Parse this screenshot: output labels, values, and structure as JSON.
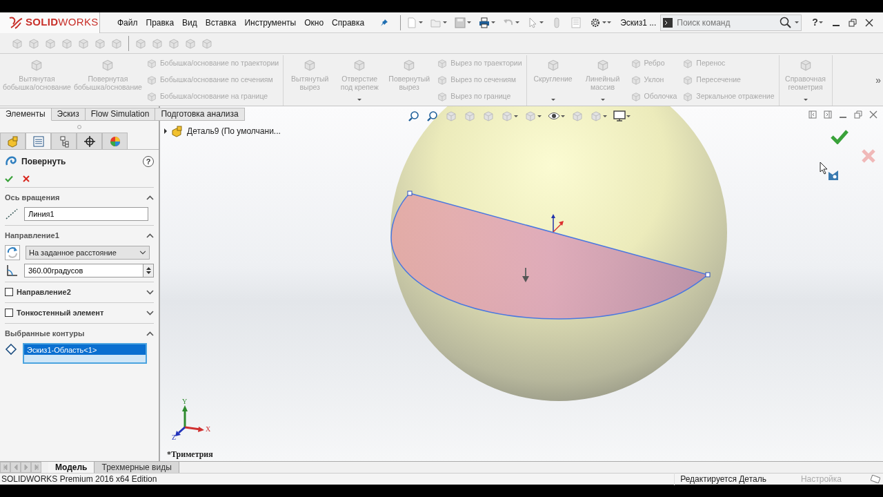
{
  "menu_bar": {
    "logo": "**SOLID**WORKS",
    "menus": [
      "Файл",
      "Правка",
      "Вид",
      "Вставка",
      "Инструменты",
      "Окно",
      "Справка"
    ],
    "document_title": "Эскиз1 ...",
    "search": {
      "placeholder": "Поиск команд"
    },
    "help": "?"
  },
  "ribbon": {
    "groups": [
      {
        "items": [
          {
            "kind": "large",
            "label": "Вытянутая бобышка/основание",
            "dropdown": false,
            "disabled": true
          },
          {
            "kind": "large",
            "label": "Повернутая бобышка/основание",
            "dropdown": false,
            "disabled": true
          },
          {
            "kind": "stack",
            "rows": [
              {
                "label": "Бобышка/основание по траектории",
                "disabled": true
              },
              {
                "label": "Бобышка/основание по сечениям",
                "disabled": true
              },
              {
                "label": "Бобышка/основание на границе",
                "disabled": true
              }
            ]
          }
        ]
      },
      {
        "items": [
          {
            "kind": "large",
            "label": "Вытянутый вырез",
            "dropdown": false,
            "disabled": true
          },
          {
            "kind": "large",
            "label": "Отверстие под крепеж",
            "dropdown": true,
            "disabled": true
          },
          {
            "kind": "large",
            "label": "Повернутый вырез",
            "dropdown": false,
            "disabled": true
          },
          {
            "kind": "stack",
            "rows": [
              {
                "label": "Вырез по траектории",
                "disabled": true
              },
              {
                "label": "Вырез по сечениям",
                "disabled": true
              },
              {
                "label": "Вырез по границе",
                "disabled": true
              }
            ]
          }
        ]
      },
      {
        "items": [
          {
            "kind": "large",
            "label": "Скругление",
            "dropdown": true,
            "disabled": true
          },
          {
            "kind": "large",
            "label": "Линейный массив",
            "dropdown": true,
            "disabled": true
          },
          {
            "kind": "stack",
            "rows": [
              {
                "label": "Ребро",
                "disabled": true
              },
              {
                "label": "Уклон",
                "disabled": true
              },
              {
                "label": "Оболочка",
                "disabled": true
              }
            ]
          },
          {
            "kind": "stack",
            "rows": [
              {
                "label": "Перенос",
                "disabled": true
              },
              {
                "label": "Пересечение",
                "disabled": true
              },
              {
                "label": "Зеркальное отражение",
                "disabled": true
              }
            ]
          }
        ]
      },
      {
        "items": [
          {
            "kind": "large",
            "label": "Справочная геометрия",
            "dropdown": true,
            "disabled": true
          }
        ]
      }
    ],
    "overflow": "»"
  },
  "command_tabs": [
    {
      "label": "Элементы",
      "selected": true
    },
    {
      "label": "Эскиз",
      "selected": false
    },
    {
      "label": "Flow Simulation",
      "selected": false
    },
    {
      "label": "Подготовка анализа",
      "selected": false
    }
  ],
  "panel_tabs": [
    {
      "kind": "parts",
      "selected": false
    },
    {
      "kind": "properties",
      "selected": true
    },
    {
      "kind": "configurations",
      "selected": false
    },
    {
      "kind": "target",
      "selected": false
    },
    {
      "kind": "appearance",
      "selected": false
    }
  ],
  "property_manager": {
    "title": "Повернуть",
    "help": "?",
    "sections": [
      {
        "kind": "axis",
        "title": "Ось вращения",
        "expanded": true,
        "value": "Линия1"
      },
      {
        "kind": "direction",
        "title": "Направление1",
        "expanded": true,
        "end_condition": "На заданное расстояние",
        "angle": "360.00градусов"
      },
      {
        "kind": "option",
        "title": "Направление2",
        "checked": false,
        "expanded": false
      },
      {
        "kind": "option",
        "title": "Тонкостенный элемент",
        "checked": false,
        "expanded": false
      },
      {
        "kind": "contours",
        "title": "Выбранные контуры",
        "expanded": true,
        "items": [
          {
            "label": "Эскиз1-Область<1>",
            "selected": true
          }
        ]
      }
    ]
  },
  "feature_tree": {
    "root": {
      "label": "Деталь9  (По умолчани...",
      "expanded": false
    }
  },
  "viewport": {
    "view_name": "*Триметрия",
    "axes": [
      "X",
      "Y",
      "Z"
    ]
  },
  "bottom_tabs": [
    {
      "label": "Модель",
      "selected": true
    },
    {
      "label": "Трехмерные виды",
      "selected": false
    }
  ],
  "status_bar": [
    {
      "text": "SOLIDWORKS Premium 2016 x64 Edition",
      "disabled": false
    },
    {
      "text": "Редактируется Деталь",
      "disabled": false
    },
    {
      "text": "Настройка",
      "disabled": true
    }
  ]
}
